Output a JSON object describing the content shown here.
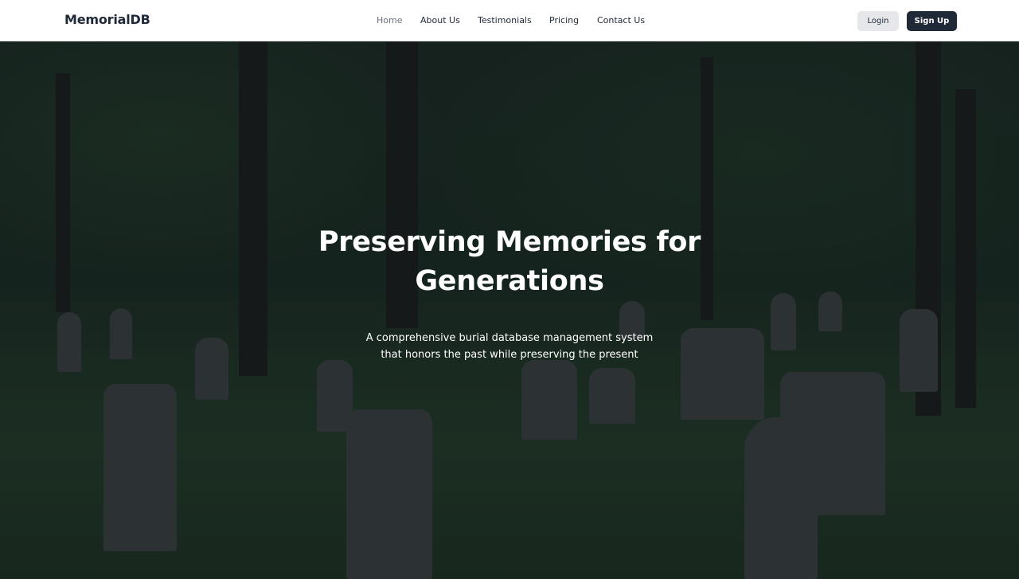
{
  "header": {
    "brand": "MemorialDB",
    "nav": [
      {
        "label": "Home",
        "active": true
      },
      {
        "label": "About Us"
      },
      {
        "label": "Testimonials"
      },
      {
        "label": "Pricing"
      },
      {
        "label": "Contact Us"
      }
    ],
    "login_label": "Login",
    "signup_label": "Sign Up"
  },
  "hero": {
    "title_line1": "Preserving Memories for",
    "title_line2": "Generations",
    "subtitle_line1": "A comprehensive burial database management system",
    "subtitle_line2": "that honors the past while preserving the present",
    "background": "cemetery-photo"
  },
  "colors": {
    "brand_text": "#1f2937",
    "signup_bg": "#1f2937",
    "login_bg": "#e5e7eb",
    "nav_active": "#6b7280"
  }
}
